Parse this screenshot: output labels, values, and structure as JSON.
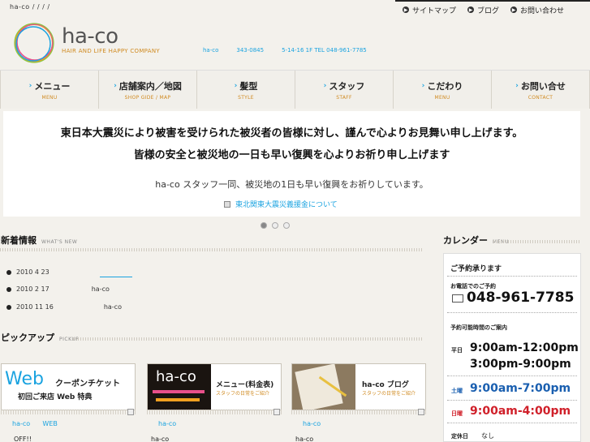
{
  "header": {
    "breadcrumb": "ha-co  /  /  /  /",
    "utility": [
      {
        "label": "サイトマップ"
      },
      {
        "label": "ブログ"
      },
      {
        "label": "お問い合わせ"
      }
    ],
    "logo_word": "ha-co",
    "logo_tagline": "HAIR AND LIFE HAPPY COMPANY",
    "contact": [
      "ha-co",
      "343-0845",
      "5-14-16 1F TEL 048-961-7785"
    ]
  },
  "nav": [
    {
      "ja": "メニュー",
      "en": "MENU"
    },
    {
      "ja": "店舗案内／地図",
      "en": "SHOP GIDE / MAP"
    },
    {
      "ja": "髪型",
      "en": "STYLE"
    },
    {
      "ja": "スタッフ",
      "en": "STAFF"
    },
    {
      "ja": "こだわり",
      "en": "MENU"
    },
    {
      "ja": "お問い合せ",
      "en": "CONTACT"
    }
  ],
  "banner": {
    "line1": "東日本大震災により被害を受けられた被災者の皆様に対し、謹んで心よりお見舞い申し上げます。",
    "line2": "皆様の安全と被災地の一日も早い復興を心よりお祈り申し上げます",
    "line3": "ha-co スタッフ一同、被災地の1日も早い復興をお祈りしています。",
    "link": "東北関東大震災義援金について"
  },
  "news": {
    "title": "新着情報",
    "subtitle": "WHAT'S NEW",
    "items": [
      {
        "date": "2010  4  23",
        "text": ""
      },
      {
        "date": "2010  2  17",
        "text": "ha-co"
      },
      {
        "date": "2010  11  16",
        "text": "ha-co"
      }
    ]
  },
  "pickup": {
    "title": "ピックアップ",
    "subtitle": "PICKUP",
    "cards": [
      {
        "web": "Web",
        "main": "クーポンチケット",
        "sub": "初回ご来店 Web 特典",
        "a": "ha-co      WEB",
        "b": "OFF!!"
      },
      {
        "logo": "ha-co",
        "main": "メニュー(料金表)",
        "sub": "スタッフの日常をご紹介",
        "a": "ha-co",
        "b": "ha-co"
      },
      {
        "logo": "ha-co",
        "main": "ha-co ブログ",
        "sub": "スタッフの日常をご紹介",
        "a": "ha-co",
        "b": "ha-co"
      }
    ]
  },
  "calendar": {
    "title": "カレンダー",
    "subtitle": "MENU",
    "reserve": "ご予約承ります",
    "phone_label": "お電話でのご予約",
    "phone": "048-961-7785",
    "hours_label": "予約可能時間のご案内",
    "weekday": "平日",
    "weekday_h1": "9:00am-12:00pm",
    "weekday_h2": "3:00pm-9:00pm",
    "sat": "土曜",
    "sat_h": "9:00am-7:00pm",
    "sun": "日曜",
    "sun_h": "9:00am-4:00pm",
    "holiday": "定休日",
    "holiday_v": "なし"
  }
}
